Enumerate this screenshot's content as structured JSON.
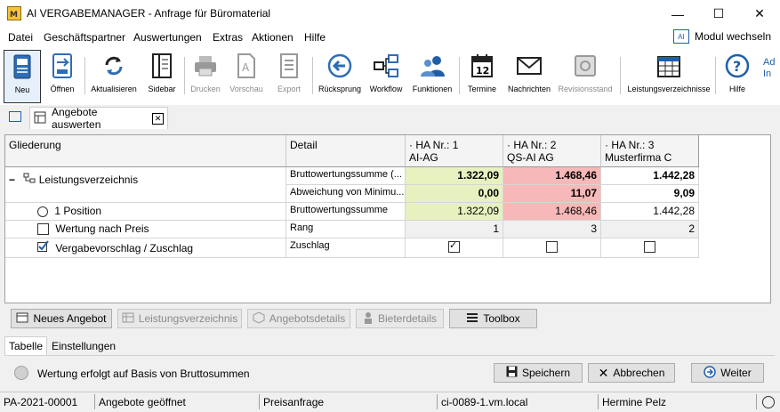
{
  "window": {
    "title": "AI VERGABEMANAGER - Anfrage für Büromaterial",
    "minimize": "—",
    "maximize": "☐",
    "close": "✕"
  },
  "menu": {
    "items": [
      "Datei",
      "Geschäftspartner",
      "Auswertungen",
      "Extras",
      "Aktionen",
      "Hilfe"
    ],
    "modul_label": "Modul wechseln",
    "modul_icon_text": "AI"
  },
  "toolbar": {
    "items": [
      {
        "label": "Neu",
        "icon": "new-document-icon"
      },
      {
        "label": "Öffnen",
        "icon": "open-folder-icon"
      },
      {
        "label": "Aktualisieren",
        "icon": "refresh-icon"
      },
      {
        "label": "Sidebar",
        "icon": "sidebar-icon"
      },
      {
        "label": "Drucken",
        "icon": "printer-icon"
      },
      {
        "label": "Vorschau",
        "icon": "preview-icon"
      },
      {
        "label": "Export",
        "icon": "export-icon"
      },
      {
        "label": "Rücksprung",
        "icon": "back-arrow-icon"
      },
      {
        "label": "Workflow",
        "icon": "workflow-icon"
      },
      {
        "label": "Funktionen",
        "icon": "users-icon"
      },
      {
        "label": "Termine",
        "icon": "calendar-icon"
      },
      {
        "label": "Nachrichten",
        "icon": "envelope-icon"
      },
      {
        "label": "Revisionsstand",
        "icon": "safe-icon"
      },
      {
        "label": "Leistungsverzeichnisse",
        "icon": "table-calendar-icon"
      },
      {
        "label": "Hilfe",
        "icon": "help-icon"
      }
    ],
    "brand_partial": "Ad In"
  },
  "document_tab": {
    "label": "Angebote auswerten",
    "close": "✕"
  },
  "grid": {
    "columns": {
      "gliederung": "Gliederung",
      "detail": "Detail",
      "bid1_line1": "HA Nr.: 1",
      "bid1_line2": "AI-AG",
      "bid2_line1": "HA Nr.: 2",
      "bid2_line2": "QS-AI AG",
      "bid3_line1": "HA Nr.: 3",
      "bid3_line2": "Musterfirma C"
    },
    "rows": {
      "lv": {
        "label": "Leistungsverzeichnis",
        "expander": "−"
      },
      "detail1": "Bruttowertungssumme (...",
      "detail2": "Abweichung von Minimu...",
      "r1": [
        "1.322,09",
        "1.468,46",
        "1.442,28"
      ],
      "r2": [
        "0,00",
        "11,07",
        "9,09"
      ],
      "pos": {
        "label": "1 Position",
        "detail": "Bruttowertungssumme",
        "values": [
          "1.322,09",
          "1.468,46",
          "1.442,28"
        ]
      },
      "preis": {
        "label": "Wertung nach Preis",
        "detail": "Rang",
        "values": [
          "1",
          "3",
          "2"
        ]
      },
      "vergabe": {
        "label": "Vergabevorschlag / Zuschlag",
        "detail": "Zuschlag",
        "checked": [
          true,
          false,
          false
        ]
      }
    }
  },
  "buttons": {
    "neues_angebot": "Neues Angebot",
    "lv": "Leistungsverzeichnis",
    "angebotsdetails": "Angebotsdetails",
    "bieterdetails": "Bieterdetails",
    "toolbox": "Toolbox",
    "speichern": "Speichern",
    "abbrechen": "Abbrechen",
    "weiter": "Weiter"
  },
  "subtabs": {
    "tabelle": "Tabelle",
    "einstellungen": "Einstellungen"
  },
  "info": {
    "text": "Wertung erfolgt auf Basis von Bruttosummen"
  },
  "status": {
    "id": "PA-2021-00001",
    "state": "Angebote geöffnet",
    "type": "Preisanfrage",
    "host": "ci-0089-1.vm.local",
    "user": "Hermine Pelz"
  },
  "colors": {
    "green_cell": "#e7f1c0",
    "red_cell": "#f6b8b8",
    "accent_blue": "#1f5fa8"
  }
}
